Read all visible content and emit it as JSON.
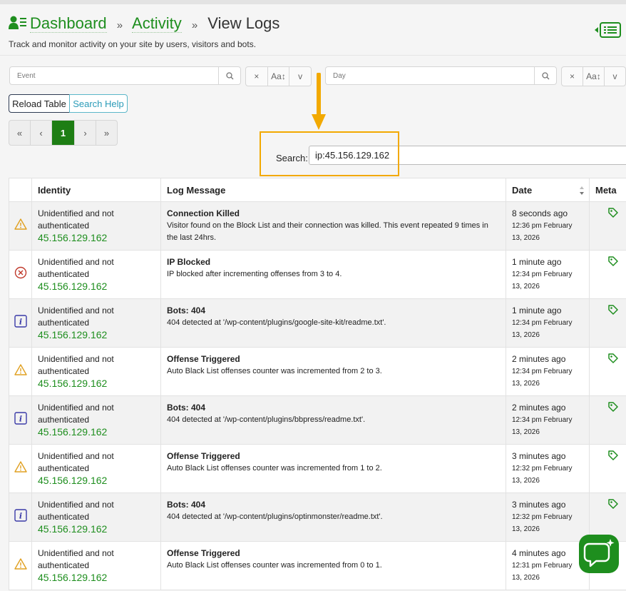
{
  "breadcrumb": {
    "dashboard": "Dashboard",
    "activity": "Activity",
    "current": "View Logs",
    "separator": "»"
  },
  "subtitle": "Track and monitor activity on your site by users, visitors and bots.",
  "filters": {
    "event_placeholder": "Event",
    "day_placeholder": "Day",
    "clear_glyph": "×",
    "case_glyph": "Aa↕",
    "dropdown_glyph": "v"
  },
  "buttons": {
    "reload": "Reload Table",
    "help": "Search Help"
  },
  "pagination": {
    "first": "«",
    "prev": "‹",
    "current": "1",
    "next": "›",
    "last": "»"
  },
  "search": {
    "label": "Search:",
    "value": "ip:45.156.129.162"
  },
  "table": {
    "headers": {
      "identity": "Identity",
      "message": "Log Message",
      "date": "Date",
      "meta": "Meta"
    },
    "rows": [
      {
        "icon": "warning",
        "identity": "Unidentified and not authenticated",
        "ip": "45.156.129.162",
        "title": "Connection Killed",
        "body": "Visitor found on the Block List and their connection was killed. This event repeated 9 times in the last 24hrs.",
        "ago": "8 seconds ago",
        "date": "12:36 pm February 13, 2026"
      },
      {
        "icon": "error",
        "identity": "Unidentified and not authenticated",
        "ip": "45.156.129.162",
        "title": "IP Blocked",
        "body": "IP blocked after incrementing offenses from 3 to 4.",
        "ago": "1 minute ago",
        "date": "12:34 pm February 13, 2026"
      },
      {
        "icon": "info",
        "identity": "Unidentified and not authenticated",
        "ip": "45.156.129.162",
        "title": "Bots: 404",
        "body": "404 detected at '/wp-content/plugins/google-site-kit/readme.txt'.",
        "ago": "1 minute ago",
        "date": "12:34 pm February 13, 2026"
      },
      {
        "icon": "warning",
        "identity": "Unidentified and not authenticated",
        "ip": "45.156.129.162",
        "title": "Offense Triggered",
        "body": "Auto Black List offenses counter was incremented from 2 to 3.",
        "ago": "2 minutes ago",
        "date": "12:34 pm February 13, 2026"
      },
      {
        "icon": "info",
        "identity": "Unidentified and not authenticated",
        "ip": "45.156.129.162",
        "title": "Bots: 404",
        "body": "404 detected at '/wp-content/plugins/bbpress/readme.txt'.",
        "ago": "2 minutes ago",
        "date": "12:34 pm February 13, 2026"
      },
      {
        "icon": "warning",
        "identity": "Unidentified and not authenticated",
        "ip": "45.156.129.162",
        "title": "Offense Triggered",
        "body": "Auto Black List offenses counter was incremented from 1 to 2.",
        "ago": "3 minutes ago",
        "date": "12:32 pm February 13, 2026"
      },
      {
        "icon": "info",
        "identity": "Unidentified and not authenticated",
        "ip": "45.156.129.162",
        "title": "Bots: 404",
        "body": "404 detected at '/wp-content/plugins/optinmonster/readme.txt'.",
        "ago": "3 minutes ago",
        "date": "12:32 pm February 13, 2026"
      },
      {
        "icon": "warning",
        "identity": "Unidentified and not authenticated",
        "ip": "45.156.129.162",
        "title": "Offense Triggered",
        "body": "Auto Black List offenses counter was incremented from 0 to 1.",
        "ago": "4 minutes ago",
        "date": "12:31 pm February 13, 2026"
      }
    ]
  },
  "colors": {
    "brand_green": "#1e8e1e",
    "highlight_orange": "#f2a900",
    "info_blue": "#3a3aa8",
    "error_red": "#c0392b",
    "warning_amber": "#e0a020"
  },
  "icons": {
    "header": "user-list-icon",
    "sidebar_toggle": "list-toggle-icon",
    "meta": "tag-icon",
    "chat": "chat-icon"
  }
}
